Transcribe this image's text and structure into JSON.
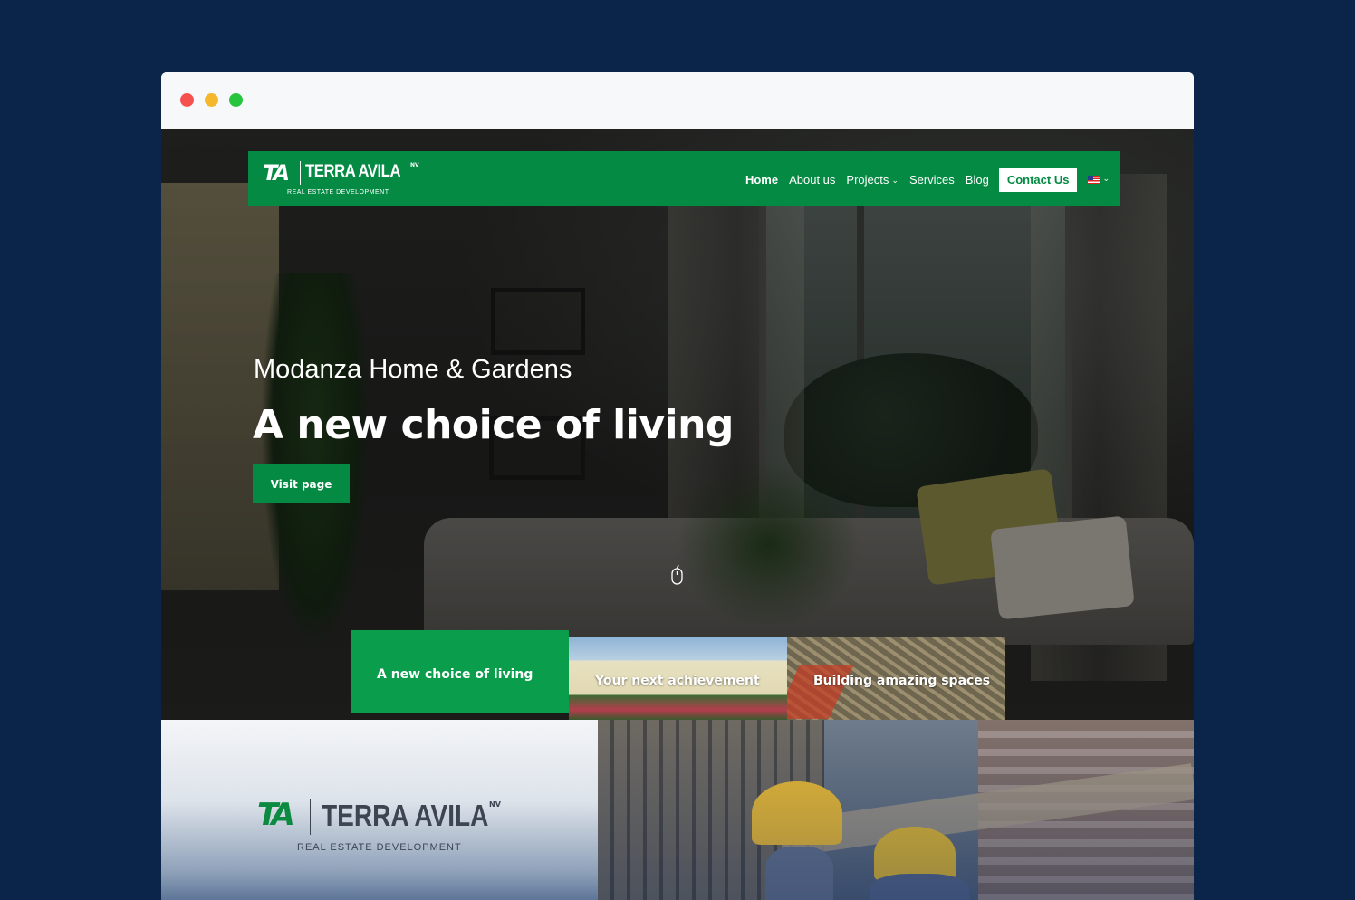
{
  "browser": {
    "controls": [
      "close",
      "minimize",
      "maximize"
    ],
    "colors": {
      "close": "#f5524f",
      "minimize": "#f4b82a",
      "maximize": "#29c43f"
    }
  },
  "brand": {
    "logo_mark": "TA",
    "name": "TERRA AVILA",
    "suffix": "NV",
    "tagline": "REAL ESTATE DEVELOPMENT",
    "color": "#048a43"
  },
  "nav": {
    "items": [
      {
        "label": "Home",
        "active": true
      },
      {
        "label": "About us"
      },
      {
        "label": "Projects",
        "has_dropdown": true
      },
      {
        "label": "Services"
      },
      {
        "label": "Blog"
      }
    ],
    "contact_label": "Contact Us",
    "language_icon": "us-flag-icon"
  },
  "hero": {
    "subtitle": "Modanza Home & Gardens",
    "title": "A new choice of living",
    "cta_label": "Visit page",
    "scroll_icon": "mouse-scroll-icon"
  },
  "slides": [
    {
      "label": "A new choice of living",
      "active": true
    },
    {
      "label": "Your next achievement"
    },
    {
      "label": "Building amazing spaces"
    }
  ],
  "section": {
    "logo_mark": "TA",
    "logo_name": "TERRA AVILA",
    "logo_suffix": "NV",
    "logo_tagline": "REAL ESTATE DEVELOPMENT"
  }
}
